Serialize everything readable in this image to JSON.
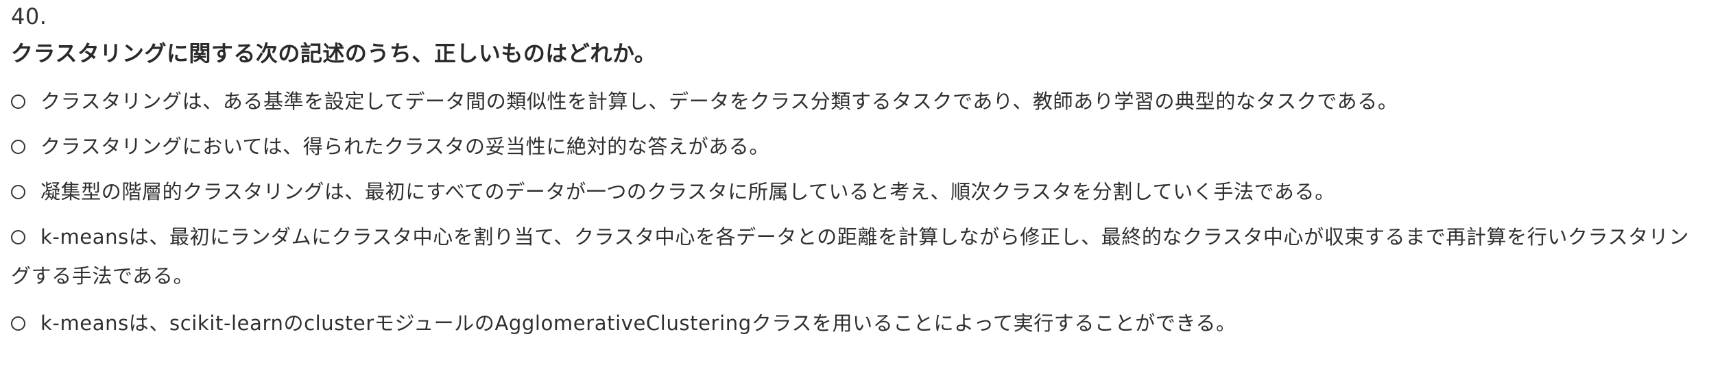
{
  "question": {
    "number": "40.",
    "text": "クラスタリングに関する次の記述のうち、正しいものはどれか。"
  },
  "options": [
    {
      "label": "クラスタリングは、ある基準を設定してデータ間の類似性を計算し、データをクラス分類するタスクであり、教師あり学習の典型的なタスクである。",
      "selected": false
    },
    {
      "label": "クラスタリングにおいては、得られたクラスタの妥当性に絶対的な答えがある。",
      "selected": false
    },
    {
      "label": "凝集型の階層的クラスタリングは、最初にすべてのデータが一つのクラスタに所属していると考え、順次クラスタを分割していく手法である。",
      "selected": false
    },
    {
      "label": "k-meansは、最初にランダムにクラスタ中心を割り当て、クラスタ中心を各データとの距離を計算しながら修正し、最終的なクラスタ中心が収束するまで再計算を行いクラスタリングする手法である。",
      "selected": false
    },
    {
      "label": "k-meansは、scikit-learnのclusterモジュールのAgglomerativeClusteringクラスを用いることによって実行することができる。",
      "selected": false
    }
  ]
}
